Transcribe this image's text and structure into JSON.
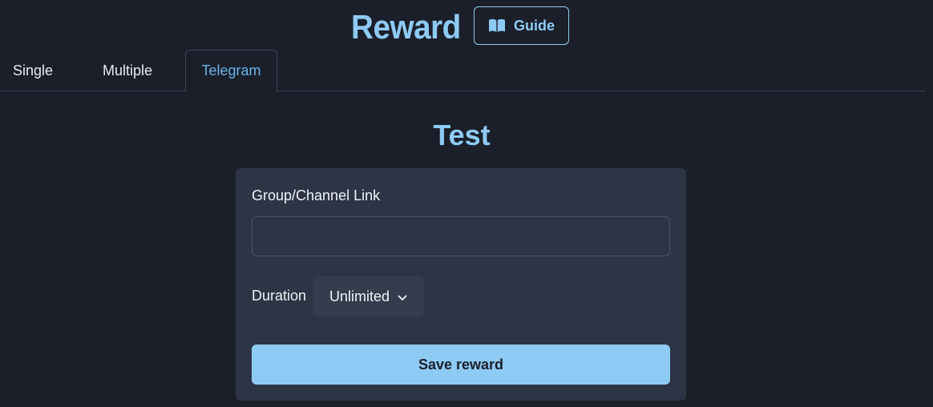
{
  "header": {
    "title": "Reward",
    "guide_label": "Guide",
    "guide_icon": "open-book-icon"
  },
  "tabs": [
    {
      "label": "Single",
      "active": false
    },
    {
      "label": "Multiple",
      "active": false
    },
    {
      "label": "Telegram",
      "active": true
    }
  ],
  "section": {
    "title": "Test"
  },
  "form": {
    "link_label": "Group/Channel Link",
    "link_value": "",
    "link_placeholder": "",
    "duration_label": "Duration",
    "duration_value": "Unlimited",
    "duration_icon": "chevron-down-icon",
    "save_label": "Save reward"
  },
  "colors": {
    "background": "#1b1f2a",
    "accent": "#8ecbf4",
    "active_tab": "#6ab4ec",
    "card": "#2d3445"
  }
}
